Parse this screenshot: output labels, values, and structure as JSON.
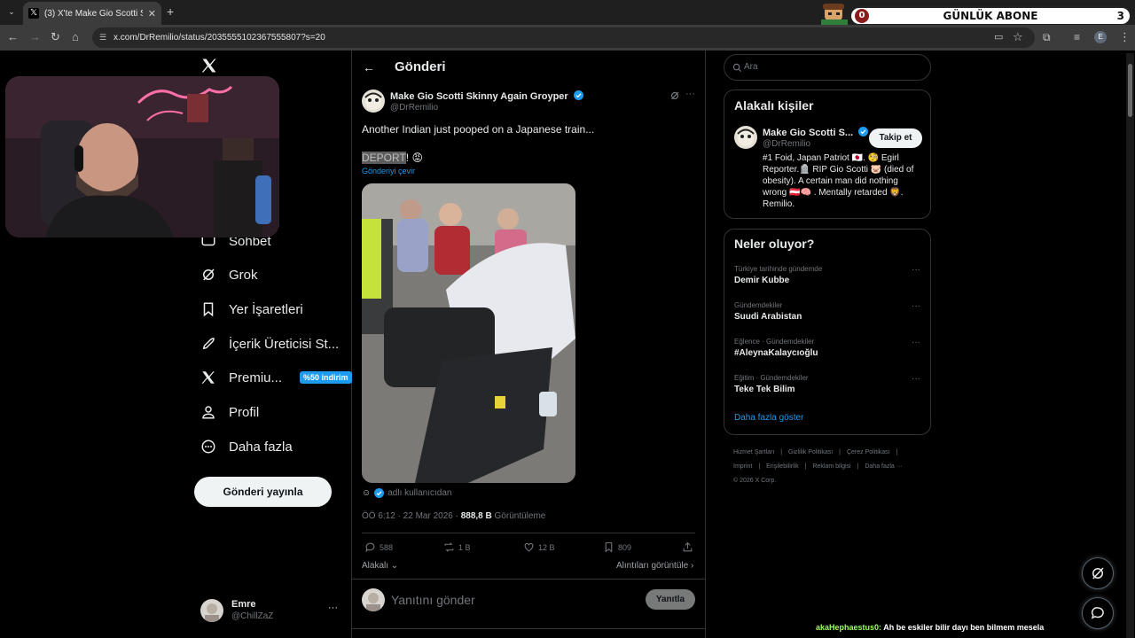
{
  "browser": {
    "tab_title": "(3) X'te Make Gio Scotti Skinny",
    "url": "x.com/DrRemilio/status/2035555102367555807?s=20",
    "profile_initial": "E"
  },
  "stream_widget": {
    "count": "0",
    "label": "GÜNLÜK ABONE",
    "goal": "3"
  },
  "nav": {
    "items": [
      {
        "label": "Sohbet",
        "icon": "chat-icon"
      },
      {
        "label": "Grok",
        "icon": "grok-icon"
      },
      {
        "label": "Yer İşaretleri",
        "icon": "bookmark-icon"
      },
      {
        "label": "İçerik Üreticisi St...",
        "icon": "rocket-icon"
      },
      {
        "label": "Premiu...",
        "icon": "x-icon"
      },
      {
        "label": "Profil",
        "icon": "person-icon"
      },
      {
        "label": "Daha fazla",
        "icon": "more-circle-icon"
      }
    ],
    "premium_badge": "%50 indirim",
    "post_button": "Gönderi yayınla",
    "account_name": "Emre",
    "account_handle": "@ChillZaZ",
    "account_more": "···"
  },
  "main": {
    "header_title": "Gönderi",
    "author_name": "Make Gio Scotti Skinny Again Groyper",
    "author_handle": "@DrRemilio",
    "text_line1": "Another Indian just pooped on a Japanese train...",
    "text_deport": "DEPORT",
    "text_deport_suffix": "! 😡",
    "translate": "Gönderiyi çevir",
    "from_user": "adlı kullanıcıdan",
    "timestamp": "ÖÖ 6:12 · 22 Mar 2026 · ",
    "views_count": "888,8 B",
    "views_label": " Görüntüleme",
    "actions": {
      "replies": "588",
      "reposts": "1 B",
      "likes": "12 B",
      "bookmarks": "809"
    },
    "relevant": "Alakalı",
    "quotes": "Alıntıları görüntüle",
    "reply_placeholder": "Yanıtını gönder",
    "reply_button": "Yanıtla"
  },
  "right": {
    "search_placeholder": "Ara",
    "related_title": "Alakalı kişiler",
    "related_name": "Make Gio Scotti S...",
    "related_handle": "@DrRemilio",
    "follow_label": "Takip et",
    "related_bio": "#1 Foid, Japan Patriot 🇯🇵. 🧐 Egirl Reporter.🪦 RIP Gio Scotti 🐷 (died of obesity). A certain man did nothing wrong 🇦🇹🧠 . Mentally retarded 🦁. Remilio.",
    "trends_title": "Neler oluyor?",
    "trends": [
      {
        "meta": "Türkiye tarihinde gündemde",
        "name": "Demir Kubbe"
      },
      {
        "meta": "Gündemdekiler",
        "name": "Suudi Arabistan"
      },
      {
        "meta": "Eğlence · Gündemdekiler",
        "name": "#AleynaKalaycıoğlu"
      },
      {
        "meta": "Eğitim · Gündemdekiler",
        "name": "Teke Tek Bilim"
      }
    ],
    "show_more": "Daha fazla göster",
    "footer": [
      "Hizmet Şartları",
      "|",
      "Gizlilik Politikası",
      "|",
      "Çerez Politikası",
      "|",
      "Imprint",
      "|",
      "Erişilebilirlik",
      "|",
      "Reklam bilgisi",
      "|",
      "Daha fazla ···",
      "© 2026 X Corp."
    ]
  },
  "chat": {
    "user": "akaHephaestus0:",
    "message": " Ah be eskiler bilir dayı ben bilmem mesela"
  }
}
